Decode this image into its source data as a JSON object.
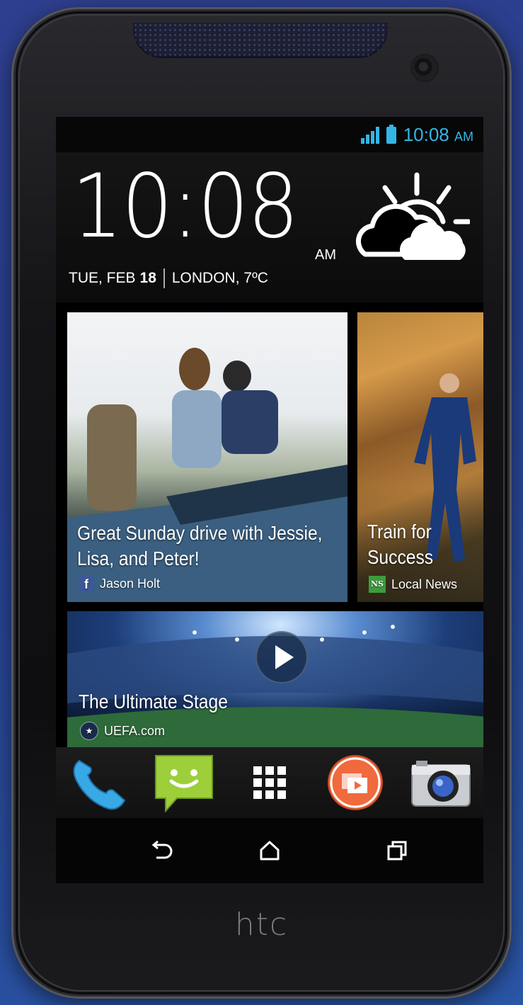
{
  "brand": {
    "logo_text": "htc"
  },
  "statusbar": {
    "time": "10:08",
    "ampm": "AM"
  },
  "clock_widget": {
    "time": "10:08",
    "ampm": "AM",
    "day_month": "TUE, FEB",
    "day_number": "18",
    "location_temp": "LONDON, 7ºC",
    "weather_icon": "partly-cloudy-icon"
  },
  "feed": {
    "friends_post": {
      "caption_line1": "Great Sunday drive with Jessie,",
      "caption_line2": "Lisa, and Peter!",
      "source": "Jason Holt",
      "source_icon": "facebook-icon"
    },
    "news_post": {
      "caption_line1": "Train for",
      "caption_line2": "Success",
      "source": "Local News",
      "source_icon": "news-icon"
    },
    "video_post": {
      "caption": "The Ultimate Stage",
      "source": "UEFA.com",
      "source_icon": "uefa-icon"
    }
  },
  "dock": {
    "items": [
      {
        "name": "phone",
        "icon": "phone-icon"
      },
      {
        "name": "messages",
        "icon": "messages-icon"
      },
      {
        "name": "all-apps",
        "icon": "app-grid-icon"
      },
      {
        "name": "zoe",
        "icon": "zoe-icon"
      },
      {
        "name": "camera",
        "icon": "camera-icon"
      }
    ]
  },
  "navbar": {
    "buttons": [
      "back",
      "home",
      "recent-apps"
    ]
  },
  "colors": {
    "accent": "#33b5e5",
    "background": "#2b4a9e",
    "dock_bg": "#1a1a1a"
  }
}
